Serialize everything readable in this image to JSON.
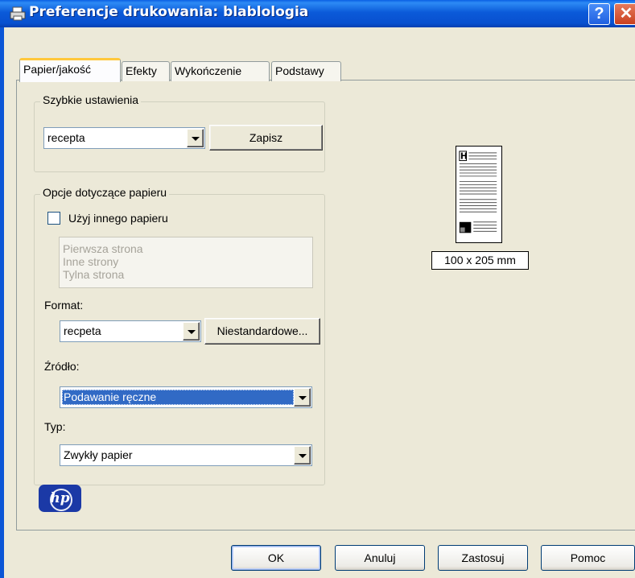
{
  "window": {
    "title": "Preferencje drukowania: blablologia",
    "help_btn": "?",
    "close_btn": "✕"
  },
  "tabs": [
    {
      "label": "Papier/jakość",
      "active": true
    },
    {
      "label": "Efekty",
      "active": false
    },
    {
      "label": "Wykończenie",
      "active": false
    },
    {
      "label": "Podstawy",
      "active": false
    }
  ],
  "quick_settings": {
    "legend": "Szybkie ustawienia",
    "combo_value": "recepta",
    "save_label": "Zapisz"
  },
  "paper_options": {
    "legend": "Opcje dotyczące papieru",
    "use_other_paper_label": "Użyj innego papieru",
    "use_other_paper_checked": false,
    "pages": [
      "Pierwsza strona",
      "Inne strony",
      "Tylna strona"
    ],
    "format_label": "Format:",
    "format_value": "recpeta",
    "custom_label": "Niestandardowe...",
    "source_label": "Źródło:",
    "source_value": "Podawanie ręczne",
    "type_label": "Typ:",
    "type_value": "Zwykły papier"
  },
  "preview": {
    "size_label": "100 x 205 mm",
    "header_glyph": "H"
  },
  "logo": {
    "text": "hp"
  },
  "buttons": {
    "ok": "OK",
    "cancel": "Anuluj",
    "apply": "Zastosuj",
    "help": "Pomoc"
  },
  "colors": {
    "titlebar": "#0b5ad9",
    "dialog_bg": "#ece9d8",
    "active_tab_accent": "#ffc83c",
    "selection": "#316ac5",
    "hp_blue": "#1b39a6"
  }
}
